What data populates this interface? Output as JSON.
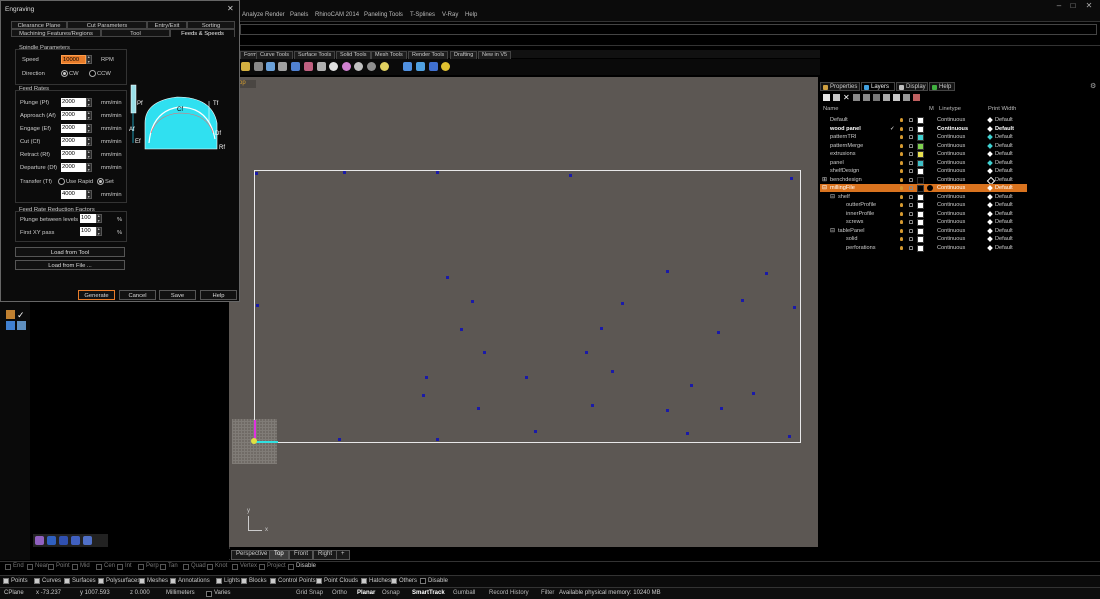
{
  "menubar": {
    "items": [
      "Analyze",
      "Render",
      "Panels",
      "RhinoCAM 2014",
      "Paneling Tools",
      "T-Splines",
      "V-Ray",
      "Help"
    ],
    "win_min": "–",
    "win_max": "□",
    "win_close": "✕"
  },
  "toolbar_tabs": [
    "Form",
    "Curve Tools",
    "Surface Tools",
    "Solid Tools",
    "Mesh Tools",
    "Render Tools",
    "Drafting",
    "New in V5"
  ],
  "viewport": {
    "title": "Top",
    "axis_x": "x",
    "axis_y": "y",
    "tabs": [
      "Perspective",
      "Top",
      "Front",
      "Right"
    ],
    "add_tab": "+"
  },
  "dialog": {
    "title": "Engraving",
    "close": "✕",
    "tabs_row1": [
      "Clearance Plane",
      "Cut Parameters",
      "Entry/Exit",
      "Sorting"
    ],
    "tabs_row2": [
      "Machining Features/Regions",
      "Tool",
      "Feeds & Speeds"
    ],
    "spindle": {
      "section": "Spindle Parameters",
      "speed_label": "Speed",
      "speed_value": "10000",
      "speed_unit": "RPM",
      "direction_label": "Direction",
      "cw": "CW",
      "ccw": "CCW"
    },
    "feed": {
      "section": "Feed Rates",
      "rows": [
        {
          "label": "Plunge (Pf)",
          "value": "2000",
          "unit": "mm/min"
        },
        {
          "label": "Approach (Af)",
          "value": "2000",
          "unit": "mm/min"
        },
        {
          "label": "Engage (Ef)",
          "value": "2000",
          "unit": "mm/min"
        },
        {
          "label": "Cut (Cf)",
          "value": "2000",
          "unit": "mm/min"
        },
        {
          "label": "Retract (Rf)",
          "value": "2000",
          "unit": "mm/min"
        },
        {
          "label": "Departure (Df)",
          "value": "2000",
          "unit": "mm/min"
        }
      ],
      "transfer_label": "Transfer (Tf)",
      "use_rapid": "Use Rapid",
      "set": "Set",
      "transfer_value": "4000",
      "transfer_unit": "mm/min"
    },
    "reduction": {
      "section": "Feed Rate Reduction Factors",
      "rows": [
        {
          "label": "Plunge between levels",
          "value": "100",
          "unit": "%"
        },
        {
          "label": "First XY pass",
          "value": "100",
          "unit": "%"
        }
      ]
    },
    "diagram_labels": {
      "pf": "Pf",
      "tf": "Tf",
      "cf": "Cf",
      "af": "Af",
      "ef": "Ef",
      "df": "Df",
      "rf": "Rf"
    },
    "load_from_tool": "Load from Tool",
    "load_from_file": "Load from File ...",
    "generate": "Generate",
    "cancel": "Cancel",
    "save": "Save",
    "help": "Help"
  },
  "right_panel": {
    "tabs": [
      "Properties",
      "Layers",
      "Display",
      "Help"
    ],
    "columns": {
      "name": "Name",
      "material": "M",
      "linetype": "Linetype",
      "print_width": "Print Width"
    },
    "layers": [
      {
        "name": "Default",
        "indent": 0,
        "color": "#ffffff",
        "linetype": "Continuous",
        "pw": "Default",
        "bold": false,
        "sel": false,
        "check": ""
      },
      {
        "name": "wood panel",
        "indent": 0,
        "color": "#ffffff",
        "linetype": "Continuous",
        "pw": "Default",
        "bold": true,
        "sel": false,
        "check": "✓"
      },
      {
        "name": "patternTRI",
        "indent": 0,
        "color": "#3fd0d0",
        "linetype": "Continuous",
        "pw": "Default",
        "bold": false,
        "sel": false,
        "check": ""
      },
      {
        "name": "patternMerge",
        "indent": 0,
        "color": "#7fd04f",
        "linetype": "Continuous",
        "pw": "Default",
        "bold": false,
        "sel": false,
        "check": ""
      },
      {
        "name": "extrusions",
        "indent": 0,
        "color": "#e8e04f",
        "linetype": "Continuous",
        "pw": "Default",
        "bold": false,
        "sel": false,
        "check": ""
      },
      {
        "name": "panel",
        "indent": 0,
        "color": "#3fc0c8",
        "linetype": "Continuous",
        "pw": "Default",
        "bold": false,
        "sel": false,
        "check": ""
      },
      {
        "name": "shelfDesign",
        "indent": 0,
        "color": "#ffffff",
        "linetype": "Continuous",
        "pw": "Default",
        "bold": false,
        "sel": false,
        "check": ""
      },
      {
        "name": "benchdesign",
        "indent": 0,
        "color": "#000000",
        "linetype": "Continuous",
        "pw": "Default",
        "bold": false,
        "sel": false,
        "check": ""
      },
      {
        "name": "millingFile",
        "indent": 0,
        "color": "#000000",
        "linetype": "Continuous",
        "pw": "Default",
        "bold": false,
        "sel": true,
        "check": ""
      },
      {
        "name": "shelf",
        "indent": 1,
        "color": "#ffffff",
        "linetype": "Continuous",
        "pw": "Default",
        "bold": false,
        "sel": false,
        "check": ""
      },
      {
        "name": "outterProfile",
        "indent": 2,
        "color": "#ffffff",
        "linetype": "Continuous",
        "pw": "Default",
        "bold": false,
        "sel": false,
        "check": ""
      },
      {
        "name": "innerProfile",
        "indent": 2,
        "color": "#ffffff",
        "linetype": "Continuous",
        "pw": "Default",
        "bold": false,
        "sel": false,
        "check": ""
      },
      {
        "name": "screws",
        "indent": 2,
        "color": "#ffffff",
        "linetype": "Continuous",
        "pw": "Default",
        "bold": false,
        "sel": false,
        "check": ""
      },
      {
        "name": "tablePanel",
        "indent": 1,
        "color": "#ffffff",
        "linetype": "Continuous",
        "pw": "Default",
        "bold": false,
        "sel": false,
        "check": ""
      },
      {
        "name": "solid",
        "indent": 2,
        "color": "#ffffff",
        "linetype": "Continuous",
        "pw": "Default",
        "bold": false,
        "sel": false,
        "check": ""
      },
      {
        "name": "perforations",
        "indent": 2,
        "color": "#ffffff",
        "linetype": "Continuous",
        "pw": "Default",
        "bold": false,
        "sel": false,
        "check": ""
      }
    ]
  },
  "osnap": {
    "items": [
      "End",
      "Near",
      "Point",
      "Mid",
      "Cen",
      "Int",
      "Perp",
      "Tan",
      "Quad",
      "Knot",
      "Vertex",
      "Project",
      "Disable"
    ]
  },
  "filters": {
    "items": [
      "Points",
      "Curves",
      "Surfaces",
      "Polysurfaces",
      "Meshes",
      "Annotations",
      "Lights",
      "Blocks",
      "Control Points",
      "Point Clouds",
      "Hatches",
      "Others",
      "Disable"
    ]
  },
  "status": {
    "cplane": "CPlane",
    "x": "x -73.237",
    "y": "y 1007.593",
    "z": "z 0.000",
    "units": "Millimeters",
    "layer": "Varies",
    "toggles": [
      "Grid Snap",
      "Ortho",
      "Planar",
      "Osnap",
      "SmartTrack",
      "Gumball",
      "Record History",
      "Filter"
    ],
    "memory": "Available physical memory: 10240 MB"
  },
  "colors": {
    "accent": "#e87c2a",
    "selection": "#d9731f",
    "viewport_bg": "#5c5753",
    "points": "#1a1aa8"
  }
}
